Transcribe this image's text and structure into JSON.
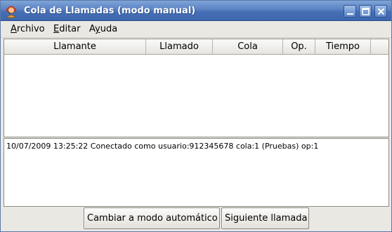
{
  "window": {
    "title": "Cola de Llamadas (modo manual)",
    "app_icon": "phone-operator-icon",
    "controls": [
      "minimize-icon",
      "maximize-icon",
      "close-icon"
    ]
  },
  "menubar": {
    "items": [
      {
        "mnemonic": "A",
        "rest": "rchivo"
      },
      {
        "mnemonic": "E",
        "rest": "ditar"
      },
      {
        "pre": "A",
        "mnemonic": "y",
        "rest": "uda"
      }
    ]
  },
  "calls_table": {
    "columns": [
      "Llamante",
      "Llamado",
      "Cola",
      "Op.",
      "Tiempo"
    ],
    "rows": []
  },
  "log": {
    "lines": [
      "10/07/2009 13:25:22 Conectado como usuario:912345678 cola:1 (Pruebas) op:1"
    ]
  },
  "buttons": {
    "auto_mode": "Cambiar a modo automático",
    "next_call": "Siguiente llamada"
  },
  "colors": {
    "titlebar": "#4670b6",
    "window_bg": "#eae8e3"
  }
}
